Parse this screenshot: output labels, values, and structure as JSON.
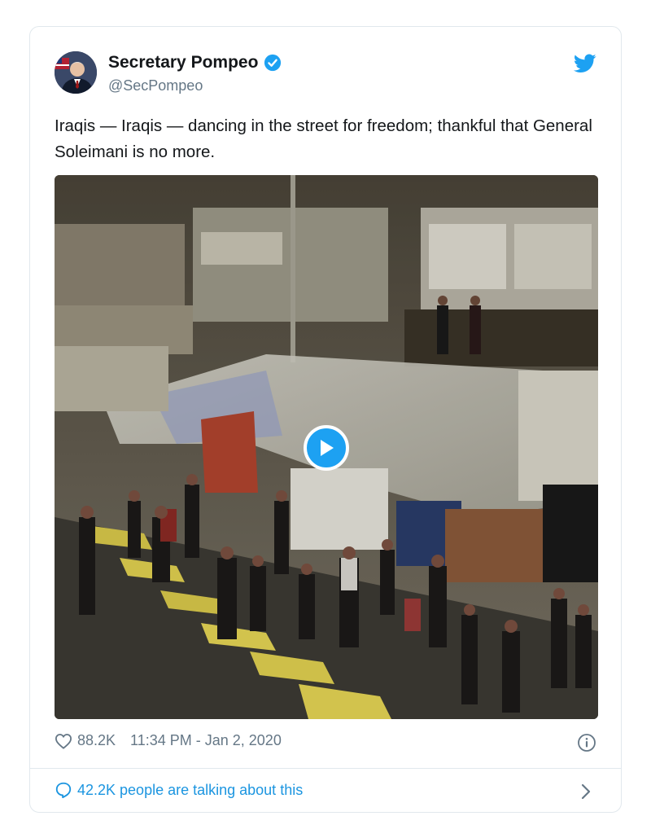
{
  "tweet": {
    "display_name": "Secretary Pompeo",
    "handle": "@SecPompeo",
    "verified": true,
    "text": "Iraqis — Iraqis — dancing in the street for freedom; thankful that General Soleimani is no more.",
    "likes": "88.2K",
    "timestamp": "11:34 PM - Jan 2, 2020",
    "conversation": "42.2K people are talking about this"
  },
  "icons": {
    "brand": "twitter-bird-icon",
    "verified": "verified-badge-icon",
    "like": "heart-icon",
    "info": "info-icon",
    "reply": "speech-bubble-icon",
    "more": "chevron-right-icon",
    "play": "play-icon"
  },
  "colors": {
    "accent": "#1da1f2",
    "link": "#1b95e0",
    "muted": "#657786",
    "text": "#14171a",
    "border": "#e1e8ed"
  }
}
